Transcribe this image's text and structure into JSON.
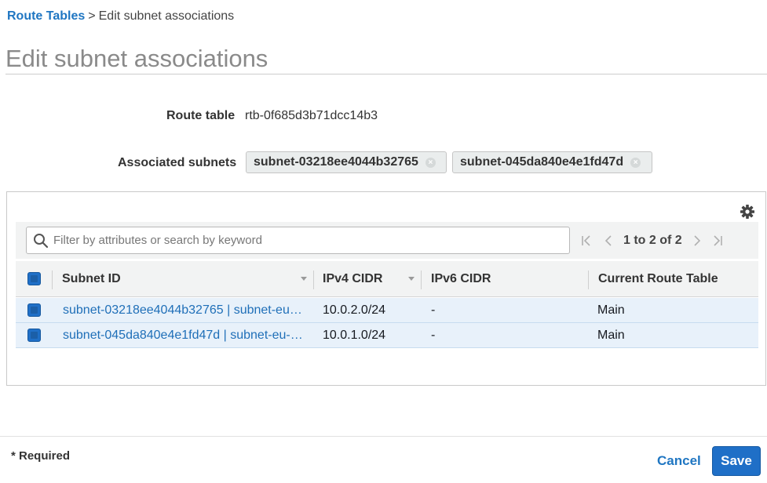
{
  "breadcrumb": {
    "root": "Route Tables",
    "separator": ">",
    "current": "Edit subnet associations"
  },
  "page_title": "Edit subnet associations",
  "form": {
    "route_table_label": "Route table",
    "route_table_value": "rtb-0f685d3b71dcc14b3",
    "associated_subnets_label": "Associated subnets",
    "tokens": [
      "subnet-03218ee4044b32765",
      "subnet-045da840e4e1fd47d"
    ]
  },
  "table": {
    "search_placeholder": "Filter by attributes or search by keyword",
    "pagination": "1 to 2 of 2",
    "columns": [
      "Subnet ID",
      "IPv4 CIDR",
      "IPv6 CIDR",
      "Current Route Table"
    ],
    "rows": [
      {
        "subnet": "subnet-03218ee4044b32765 | subnet-eu…",
        "ipv4": "10.0.2.0/24",
        "ipv6": "-",
        "route_table": "Main",
        "selected": true
      },
      {
        "subnet": "subnet-045da840e4e1fd47d | subnet-eu-…",
        "ipv4": "10.0.1.0/24",
        "ipv6": "-",
        "route_table": "Main",
        "selected": true
      }
    ]
  },
  "footer": {
    "required": "* Required",
    "cancel": "Cancel",
    "save": "Save"
  },
  "icons": {
    "settings": "gear-icon",
    "search": "search-icon",
    "first_page": "first-page-icon",
    "prev_page": "prev-page-icon",
    "next_page": "next-page-icon",
    "last_page": "last-page-icon",
    "remove_token": "remove-icon",
    "sort": "sort-caret-icon"
  },
  "colors": {
    "accent": "#1f76c2",
    "primary_button": "#1f6fc7",
    "row_selected": "#e8f1fa",
    "header_bg": "#f2f3f3"
  }
}
